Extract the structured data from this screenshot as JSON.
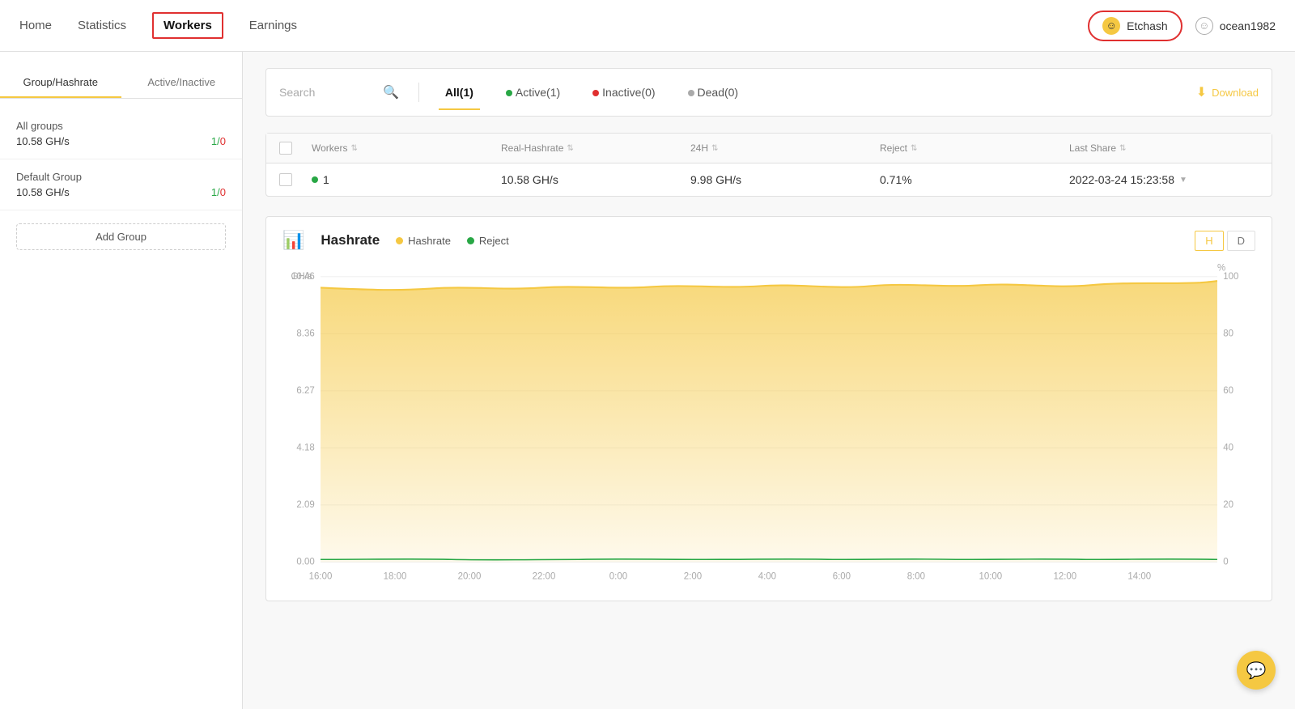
{
  "nav": {
    "links": [
      {
        "label": "Home",
        "id": "home",
        "active": false
      },
      {
        "label": "Statistics",
        "id": "statistics",
        "active": false
      },
      {
        "label": "Workers",
        "id": "workers",
        "active": true
      },
      {
        "label": "Earnings",
        "id": "earnings",
        "active": false
      }
    ],
    "etchash_label": "Etchash",
    "user_label": "ocean1982"
  },
  "sidebar": {
    "tab1": "Group/Hashrate",
    "tab2": "Active/Inactive",
    "groups": [
      {
        "name": "All groups",
        "hashrate": "10.58 GH/s",
        "active": "1",
        "inactive": "0"
      },
      {
        "name": "Default Group",
        "hashrate": "10.58 GH/s",
        "active": "1",
        "inactive": "0"
      }
    ],
    "add_group": "Add Group"
  },
  "filter": {
    "search_placeholder": "Search",
    "tabs": [
      {
        "label": "All(1)",
        "id": "all",
        "active": true,
        "dot": null
      },
      {
        "label": "Active(1)",
        "id": "active",
        "active": false,
        "dot": "green"
      },
      {
        "label": "Inactive(0)",
        "id": "inactive",
        "active": false,
        "dot": "red"
      },
      {
        "label": "Dead(0)",
        "id": "dead",
        "active": false,
        "dot": "gray"
      }
    ],
    "download_label": "Download"
  },
  "table": {
    "headers": [
      "",
      "Workers",
      "Real-Hashrate",
      "24H",
      "Reject",
      "Last Share"
    ],
    "rows": [
      {
        "worker": "1",
        "real_hashrate": "10.58 GH/s",
        "h24": "9.98 GH/s",
        "reject": "0.71%",
        "last_share": "2022-03-24 15:23:58",
        "active": true
      }
    ]
  },
  "chart": {
    "title": "Hashrate",
    "legend_hashrate": "Hashrate",
    "legend_reject": "Reject",
    "period_h": "H",
    "period_d": "D",
    "y_labels_left": [
      "10.46",
      "8.36",
      "6.27",
      "4.18",
      "2.09",
      "0.00"
    ],
    "y_labels_right": [
      "100",
      "80",
      "60",
      "40",
      "20",
      "0"
    ],
    "y_unit_left": "GH/s",
    "y_unit_right": "%",
    "x_labels": [
      "16:00",
      "18:00",
      "20:00",
      "22:00",
      "0:00",
      "2:00",
      "4:00",
      "6:00",
      "8:00",
      "10:00",
      "12:00",
      "14:00"
    ]
  }
}
